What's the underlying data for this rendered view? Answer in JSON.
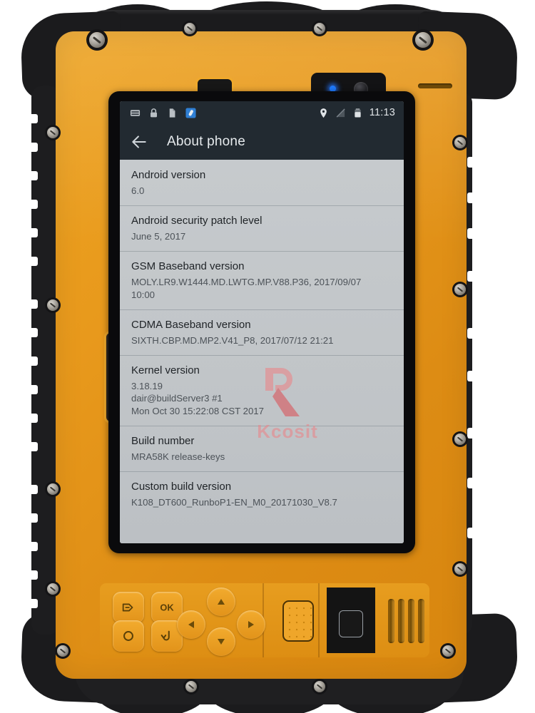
{
  "device": {
    "name": "rugged-industrial-tablet",
    "body_color": "#e8991c",
    "bumper_color": "#1b1b1d"
  },
  "screen": {
    "statusbar": {
      "left_icons": [
        "sim-card-icon",
        "lock-icon",
        "file-document-icon",
        "usb-debug-icon"
      ],
      "right_icons": [
        "location-pin-icon",
        "signal-off-icon",
        "battery-icon"
      ],
      "clock": "11:13"
    },
    "actionbar": {
      "back_icon": "back-arrow-icon",
      "title": "About phone"
    },
    "watermark": {
      "text": "Kcosit",
      "color": "#e8888c"
    },
    "list": [
      {
        "title": "Android version",
        "value": "6.0"
      },
      {
        "title": "Android security patch level",
        "value": "June 5, 2017"
      },
      {
        "title": "GSM Baseband version",
        "value": "MOLY.LR9.W1444.MD.LWTG.MP.V88.P36, 2017/09/07\n10:00"
      },
      {
        "title": "CDMA Baseband version",
        "value": "SIXTH.CBP.MD.MP2.V41_P8, 2017/07/12 21:21"
      },
      {
        "title": "Kernel version",
        "value": "3.18.19\ndair@buildServer3 #1\nMon Oct 30 15:22:08 CST 2017"
      },
      {
        "title": "Build number",
        "value": "MRA58K release-keys"
      },
      {
        "title": "Custom build version",
        "value": "K108_DT600_RunboP1-EN_M0_20171030_V8.7"
      }
    ]
  },
  "hardware": {
    "top": {
      "nfc_pad": "nfc-reader-pad",
      "camera_module": "front-camera-module",
      "led": "notification-led",
      "lens": "camera-lens",
      "earpiece": "earpiece-speaker-slot"
    },
    "left_side": {
      "port_cover": "side-port-cover"
    },
    "keypad": {
      "buttons": [
        {
          "name": "scan-trigger-button",
          "glyph": "arrow-into-box"
        },
        {
          "name": "ok-button",
          "glyph": "OK"
        },
        {
          "name": "power-button",
          "glyph": "circle"
        },
        {
          "name": "back-button",
          "glyph": "return-arrow"
        },
        {
          "name": "dpad-up-button",
          "glyph": "triangle-up"
        },
        {
          "name": "dpad-left-button",
          "glyph": "triangle-left"
        },
        {
          "name": "dpad-right-button",
          "glyph": "triangle-right"
        },
        {
          "name": "dpad-down-button",
          "glyph": "triangle-down"
        }
      ],
      "scan_button": "textured-scan-button",
      "fingerprint_sensor": "fingerprint-sensor",
      "speaker_grille": "speaker-grille"
    }
  }
}
